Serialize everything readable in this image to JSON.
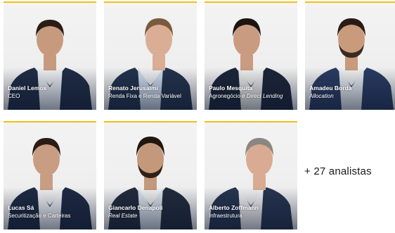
{
  "team": [
    {
      "name": "Daniel Lemos",
      "role": "CEO",
      "role_italic": "",
      "suit": "#1f2c44",
      "shirt": "#e9edf2",
      "skin": "#c79a7e",
      "hair": "#2a1d16"
    },
    {
      "name": "Renato Jerusalmi",
      "role": "Renda Fixa e Renda Variável",
      "role_italic": "",
      "suit": "#23324c",
      "shirt": "#cfdcec",
      "skin": "#d9ae95",
      "hair": "#7a5a3c"
    },
    {
      "name": "Paulo Mesquita",
      "role": "Agronegócio e ",
      "role_italic": "Direct Lending",
      "suit": "#1c2438",
      "shirt": "#ecebe8",
      "skin": "#c99b80",
      "hair": "#1c1410"
    },
    {
      "name": "Amadeu Borda",
      "role": "",
      "role_italic": "Allocation",
      "suit": "#2a3b62",
      "shirt": "#e8ecf0",
      "skin": "#c99a7c",
      "hair": "#2a1c15"
    },
    {
      "name": "Lucas Sá",
      "role": "Securitização e Carteiras",
      "role_italic": "",
      "suit": "#1e2a42",
      "shirt": "#eef0f3",
      "skin": "#c99d82",
      "hair": "#2a1c14"
    },
    {
      "name": "Giancarlo Denapoli",
      "role": "",
      "role_italic": "Real Estate",
      "suit": "#222b3c",
      "shirt": "#dbe3ec",
      "skin": "#c4987a",
      "hair": "#22170f"
    },
    {
      "name": "Alberto Zoffmann",
      "role": "Infraestrutura",
      "role_italic": "",
      "suit": "#26344f",
      "shirt": "#f0f0f0",
      "skin": "#d8ab92",
      "hair": "#8b8680"
    }
  ],
  "more_label": "+ 27 analistas",
  "accent_color": "#f2c011"
}
